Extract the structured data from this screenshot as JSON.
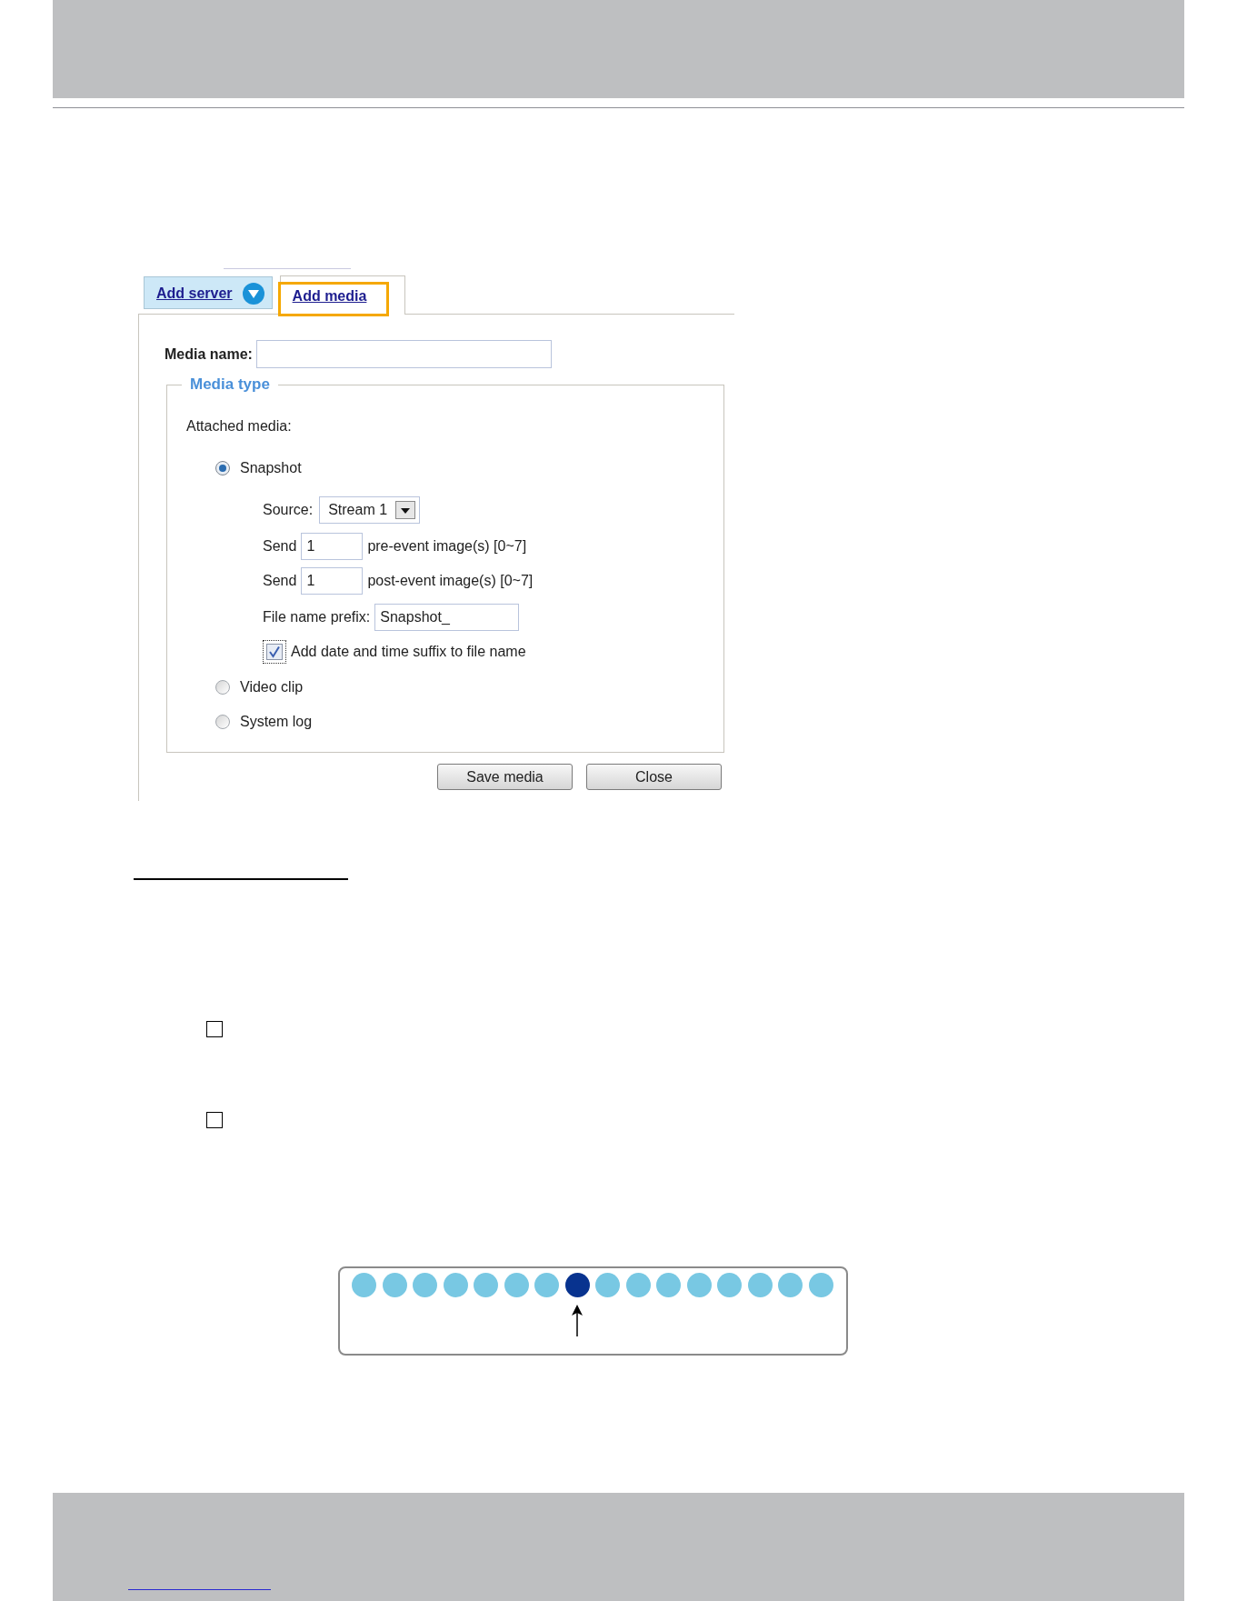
{
  "tabs": [
    {
      "label": "Add server",
      "selected": false,
      "highlighted": false
    },
    {
      "label": "Add media",
      "selected": true,
      "highlighted": true
    }
  ],
  "form": {
    "media_name": {
      "label": "Media name:"
    },
    "media_type": {
      "legend": "Media type",
      "attached_label": "Attached media:",
      "options": [
        {
          "label": "Snapshot",
          "selected": true,
          "settings": {
            "source": {
              "label": "Source:",
              "value": "Stream 1"
            },
            "send_rows": [
              {
                "label": "Send",
                "value": "1",
                "note": "pre-event image(s) [0~7]"
              },
              {
                "label": "Send",
                "value": "1",
                "note": "post-event image(s) [0~7]"
              }
            ],
            "prefix": {
              "label": "File name prefix:",
              "value": "Snapshot_"
            },
            "suffix": {
              "label": "Add date and time suffix to file name",
              "checked": true
            }
          }
        },
        {
          "label": "Video clip",
          "selected": false
        },
        {
          "label": "System log",
          "selected": false
        }
      ]
    },
    "buttons": [
      "Save media",
      "Close"
    ]
  },
  "checklist": [
    {
      "checked": false
    },
    {
      "checked": false
    }
  ],
  "diagram": {
    "dots": [
      {
        "color": "#78c8e3",
        "selected": false
      },
      {
        "color": "#78c8e3",
        "selected": false
      },
      {
        "color": "#78c8e3",
        "selected": false
      },
      {
        "color": "#78c8e3",
        "selected": false
      },
      {
        "color": "#78c8e3",
        "selected": false
      },
      {
        "color": "#78c8e3",
        "selected": false
      },
      {
        "color": "#78c8e3",
        "selected": false
      },
      {
        "color": "#08338f",
        "selected": true
      },
      {
        "color": "#78c8e3",
        "selected": false
      },
      {
        "color": "#78c8e3",
        "selected": false
      },
      {
        "color": "#78c8e3",
        "selected": false
      },
      {
        "color": "#78c8e3",
        "selected": false
      },
      {
        "color": "#78c8e3",
        "selected": false
      },
      {
        "color": "#78c8e3",
        "selected": false
      },
      {
        "color": "#78c8e3",
        "selected": false
      },
      {
        "color": "#78c8e3",
        "selected": false
      }
    ]
  }
}
